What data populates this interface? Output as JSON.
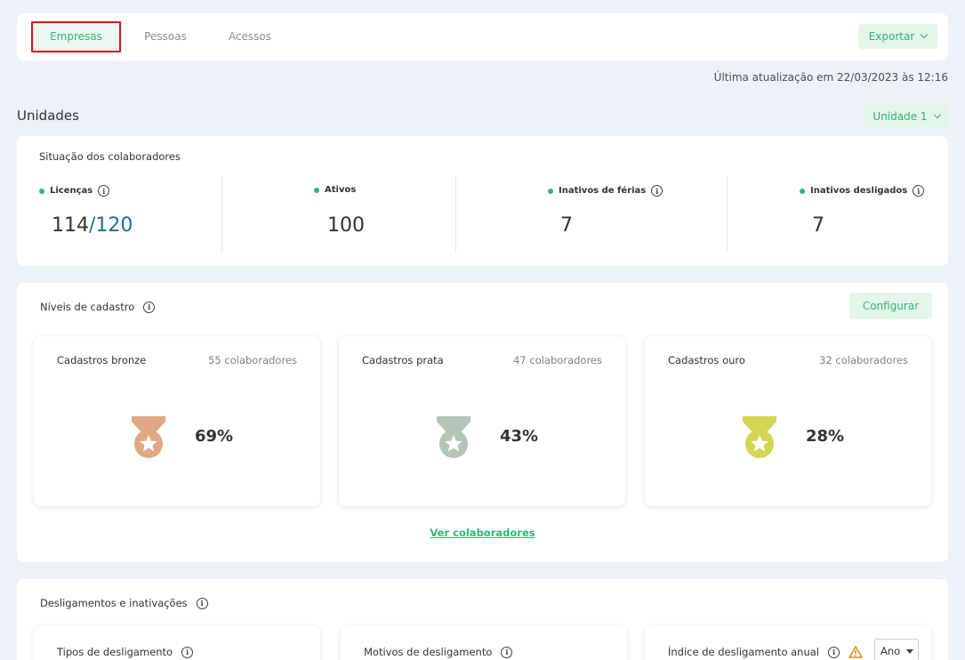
{
  "tabs": [
    {
      "label": "Empresas",
      "active": true
    },
    {
      "label": "Pessoas",
      "active": false
    },
    {
      "label": "Acessos",
      "active": false
    }
  ],
  "export_label": "Exportar",
  "last_update": "Última atualização em 22/03/2023 às 12:16",
  "section_title": "Unidades",
  "unit_selector": "Unidade 1",
  "situation": {
    "title": "Situação dos colaboradores",
    "stats": [
      {
        "label": "Licenças",
        "value": "114",
        "total": "/120"
      },
      {
        "label": "Ativos",
        "value": "100"
      },
      {
        "label": "Inativos de férias",
        "value": "7"
      },
      {
        "label": "Inativos desligados",
        "value": "7"
      }
    ]
  },
  "levels": {
    "title": "Níveis de cadastro",
    "configure_label": "Configurar",
    "cards": [
      {
        "name": "Cadastros bronze",
        "count": "55 colaboradores",
        "percent": "69%",
        "color": "#e0a882"
      },
      {
        "name": "Cadastros prata",
        "count": "47 colaboradores",
        "percent": "43%",
        "color": "#b5c4bb"
      },
      {
        "name": "Cadastros ouro",
        "count": "32 colaboradores",
        "percent": "28%",
        "color": "#d4d553"
      }
    ],
    "link_label": "Ver colaboradores"
  },
  "dismissals": {
    "title": "Desligamentos e inativações",
    "cards": [
      {
        "name": "Tipos de desligamento"
      },
      {
        "name": "Motivos de desligamento"
      },
      {
        "name": "Índice de desligamento anual",
        "select_value": "Ano"
      }
    ]
  },
  "colors": {
    "accent": "#2cb873",
    "accent_bg": "#e4f5ea",
    "highlight": "#d7151b",
    "license_total": "#1d6f93"
  }
}
